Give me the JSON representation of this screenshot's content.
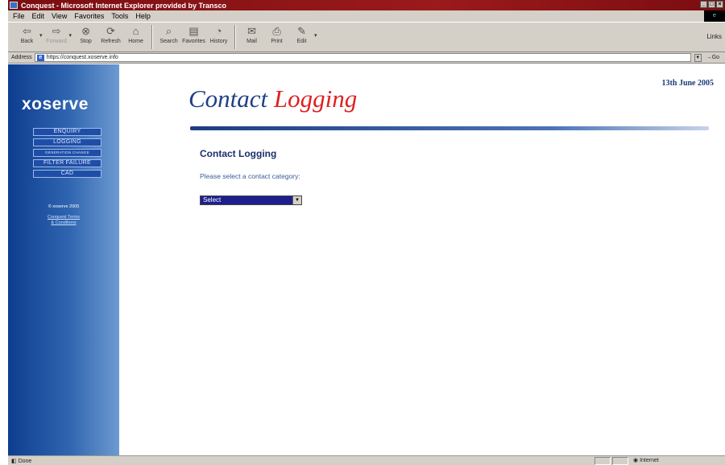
{
  "window": {
    "title": "Conquest - Microsoft Internet Explorer provided by Transco"
  },
  "menu": {
    "items": [
      "File",
      "Edit",
      "View",
      "Favorites",
      "Tools",
      "Help"
    ]
  },
  "toolbar": {
    "buttons": [
      {
        "label": "Back",
        "icon": "back-arrow-icon"
      },
      {
        "label": "Forward",
        "icon": "forward-arrow-icon"
      },
      {
        "label": "Stop",
        "icon": "stop-icon"
      },
      {
        "label": "Refresh",
        "icon": "refresh-icon"
      },
      {
        "label": "Home",
        "icon": "home-icon"
      },
      {
        "label": "Search",
        "icon": "search-icon"
      },
      {
        "label": "Favorites",
        "icon": "favorites-icon"
      },
      {
        "label": "History",
        "icon": "history-icon"
      },
      {
        "label": "Mail",
        "icon": "mail-icon"
      },
      {
        "label": "Print",
        "icon": "print-icon"
      },
      {
        "label": "Edit",
        "icon": "edit-icon"
      }
    ],
    "links_label": "Links"
  },
  "address": {
    "label": "Address",
    "url": "https://conquest.xoserve.info",
    "go_label": "Go"
  },
  "sidebar": {
    "logo": "xoserve",
    "nav": [
      "ENQUIRY",
      "LOGGING",
      "GENERATION CHANGE",
      "FILTER FAILURE",
      "CAD"
    ],
    "copyright": "© xoserve 2005",
    "terms_line1": "Conquest Terms",
    "terms_line2": "& Conditions"
  },
  "page": {
    "date": "13th June 2005",
    "banner_part1": "Contact ",
    "banner_part2": "Logging",
    "heading": "Contact Logging",
    "prompt": "Please select a contact category:",
    "select_value": "Select"
  },
  "status": {
    "left": "Done",
    "zone": "Internet"
  },
  "colors": {
    "titlebar": "#8b1517",
    "sidebar": "#2f65b0",
    "banner_blue": "#1f3f86",
    "banner_red": "#e02020"
  }
}
